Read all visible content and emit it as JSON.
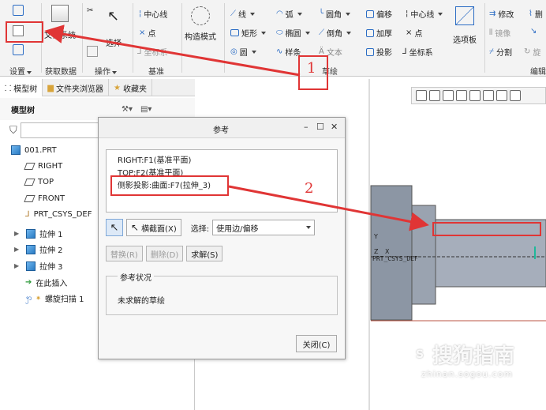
{
  "ribbon": {
    "groups": {
      "settings": "设置",
      "get_data": "获取数据",
      "operations": "操作",
      "datum": "基准",
      "sketch": "草绘",
      "edit": "编辑"
    },
    "file_system": "文件系统",
    "select": "选择",
    "construction_mode": "构造模式",
    "selection_panel": "选项板",
    "datum_items": {
      "centerline": "中心线",
      "point": "点",
      "csys": "坐标系"
    },
    "sketch_items": {
      "line": "线",
      "arc": "弧",
      "fillet": "圆角",
      "offset": "偏移",
      "centerline": "中心线",
      "rectangle": "矩形",
      "ellipse": "椭圆",
      "chamfer": "倒角",
      "thicken": "加厚",
      "point": "点",
      "circle": "圆",
      "spline": "样条",
      "text": "文本",
      "project": "投影",
      "csys": "坐标系"
    },
    "edit_items": {
      "modify": "修改",
      "delete_segment": "删",
      "mirror": "镜像",
      "divide": "分割",
      "rotate_resize": "旋"
    }
  },
  "panel": {
    "tabs": [
      "模型树",
      "文件夹浏览器",
      "收藏夹"
    ],
    "tree_title": "模型树",
    "tree": [
      {
        "label": "001.PRT",
        "type": "part"
      },
      {
        "label": "RIGHT",
        "type": "plane"
      },
      {
        "label": "TOP",
        "type": "plane"
      },
      {
        "label": "FRONT",
        "type": "plane"
      },
      {
        "label": "PRT_CSYS_DEF",
        "type": "csys"
      },
      {
        "label": "拉伸 1",
        "type": "feature"
      },
      {
        "label": "拉伸 2",
        "type": "feature"
      },
      {
        "label": "拉伸 3",
        "type": "feature"
      },
      {
        "label": "在此插入",
        "type": "insert"
      },
      {
        "label": "螺旋扫描 1",
        "type": "sweep"
      }
    ]
  },
  "dialog": {
    "title": "参考",
    "refs": [
      "RIGHT:F1(基准平面)",
      "TOP:F2(基准平面)",
      "侧影投影:曲面:F7(拉伸_3)"
    ],
    "section_button": "横截面(X)",
    "select_label": "选择:",
    "select_value": "使用边/偏移",
    "replace": "替换(R)",
    "delete": "删除(D)",
    "solve": "求解(S)",
    "status_legend": "参考状况",
    "status_text": "未求解的草绘",
    "close": "关闭(C)"
  },
  "graphics": {
    "csys_label": "PRT_CSYS_DEF",
    "axis_y": "Y",
    "axis_x": "X",
    "axis_z": "Z"
  },
  "annotations": {
    "one": "1",
    "two": "2"
  },
  "watermark": {
    "main": "搜狗指南",
    "sub": "zhinan.sogou.com"
  },
  "colors": {
    "accent": "#2b6cc4",
    "annotation": "#e03535",
    "model_gray": "#8c96a4"
  }
}
